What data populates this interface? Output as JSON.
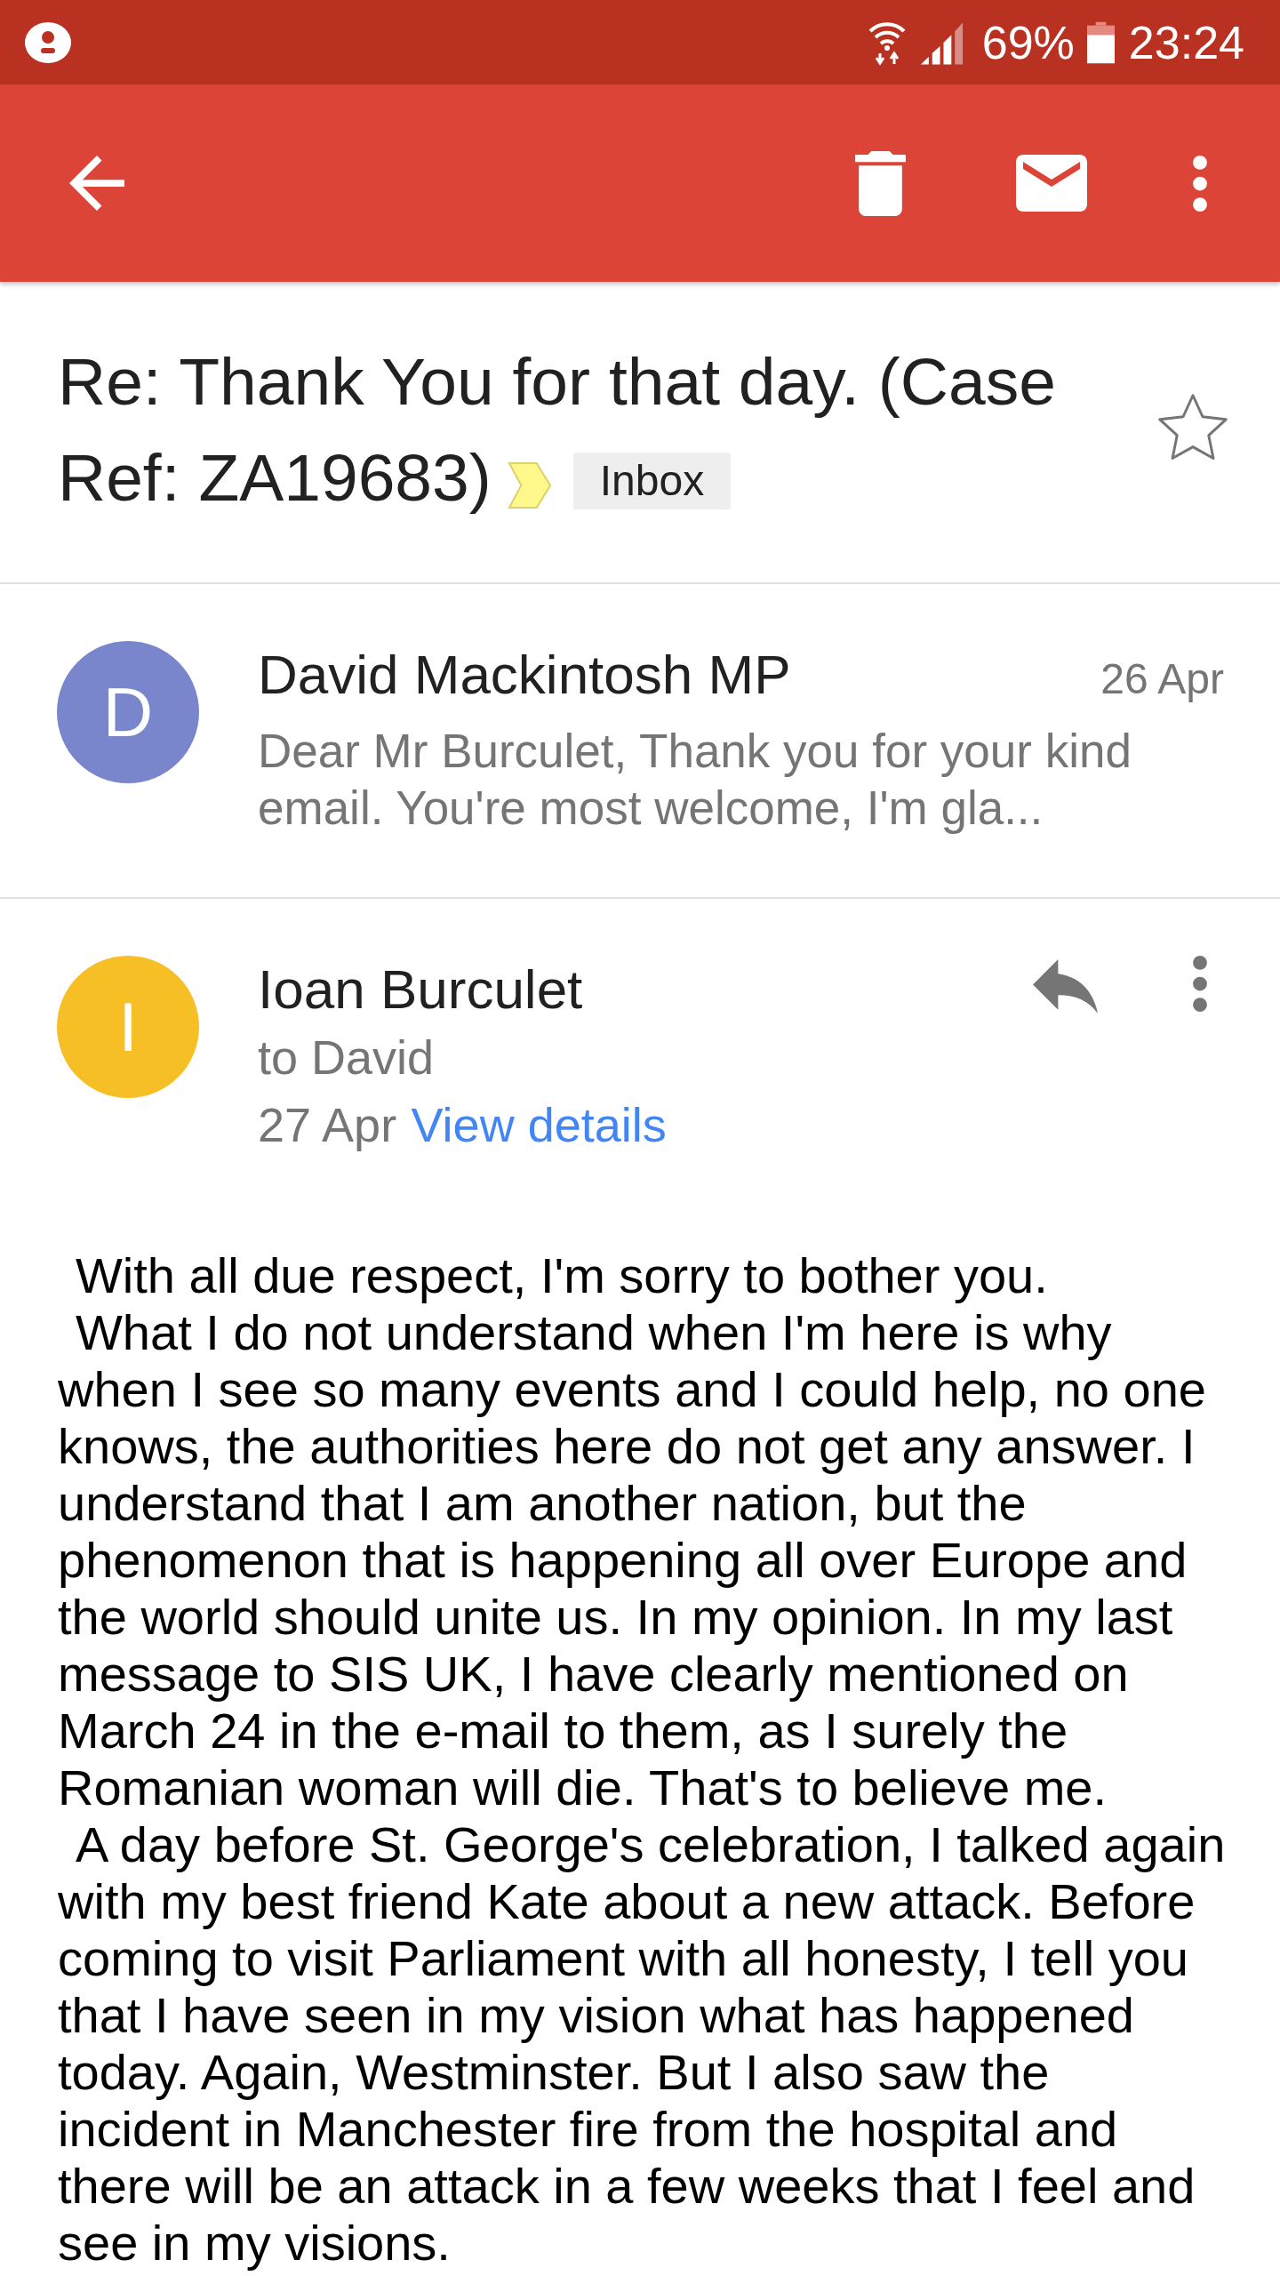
{
  "status_bar": {
    "battery": "69%",
    "time": "23:24"
  },
  "conversation": {
    "subject_lines": [
      "Re: Thank You for that day. (Case",
      "Ref: ZA19683)"
    ],
    "important": true,
    "label": "Inbox",
    "starred": false
  },
  "messages": [
    {
      "sender": "David Mackintosh MP",
      "initial": "D",
      "color": "#7986cb",
      "date": "26 Apr",
      "expanded": false,
      "snippet": "Dear Mr Burculet, Thank you for your kind email. You're most welcome, I'm gla..."
    },
    {
      "sender": "Ioan Burculet",
      "initial": "I",
      "color": "#f6bf26",
      "date": "27 Apr",
      "expanded": true,
      "recipients": "to David",
      "details_link": "View details",
      "body": [
        "With all due respect, I'm sorry to bother you.",
        "What I do not understand when I'm here is why when I see so many events and I could help, no one knows, the authorities here do not get any answer. I understand that I am another nation, but the phenomenon that is happening all over Europe and the world should unite us. In my opinion. In my last message to SIS UK, I have clearly mentioned on March 24 in the e-mail to them, as I surely the Romanian woman will die. That's to believe me.",
        "A day before St. George's celebration, I talked again with my best friend Kate about a new attack. Before coming to visit Parliament with all honesty, I tell you that I have seen in my vision what has happened today. Again, Westminster. But I also saw the incident in Manchester fire from the hospital and there will be an attack in a few weeks that I feel and see in my visions."
      ]
    }
  ]
}
